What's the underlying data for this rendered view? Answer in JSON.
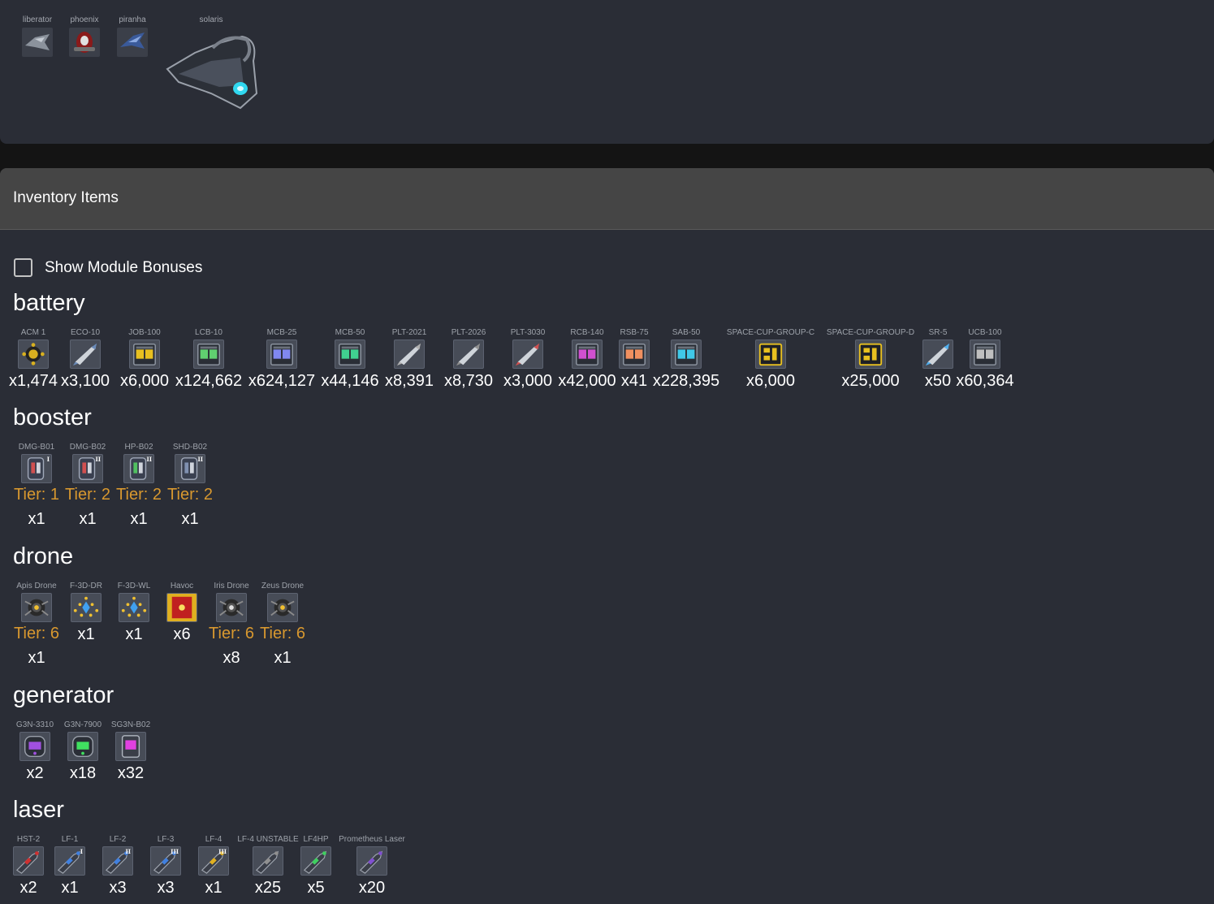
{
  "ships": [
    {
      "name": "liberator",
      "icon": "liberator-ship-icon"
    },
    {
      "name": "phoenix",
      "icon": "phoenix-ship-icon"
    },
    {
      "name": "piranha",
      "icon": "piranha-ship-icon"
    },
    {
      "name": "solaris",
      "icon": "solaris-ship-icon"
    }
  ],
  "inventory": {
    "title": "Inventory Items",
    "show_bonuses_label": "Show Module Bonuses",
    "show_bonuses_checked": false,
    "categories": [
      {
        "name": "battery",
        "items": [
          {
            "name": "ACM 1",
            "qty": "x1,474",
            "icon": "mine-icon",
            "color": "#d8b020"
          },
          {
            "name": "ECO-10",
            "qty": "x3,100",
            "icon": "rocket-icon",
            "color": "#6a8ab8"
          },
          {
            "name": "JOB-100",
            "qty": "x6,000",
            "icon": "ammo-box-icon",
            "color": "#e8c020"
          },
          {
            "name": "LCB-10",
            "qty": "x124,662",
            "icon": "ammo-box-icon",
            "color": "#60d070"
          },
          {
            "name": "MCB-25",
            "qty": "x624,127",
            "icon": "ammo-box-icon",
            "color": "#8088f0"
          },
          {
            "name": "MCB-50",
            "qty": "x44,146",
            "icon": "ammo-box-icon",
            "color": "#40d090"
          },
          {
            "name": "PLT-2021",
            "qty": "x8,391",
            "icon": "rocket-icon",
            "color": "#b0b0b0"
          },
          {
            "name": "PLT-2026",
            "qty": "x8,730",
            "icon": "rocket-icon",
            "color": "#909090"
          },
          {
            "name": "PLT-3030",
            "qty": "x3,000",
            "icon": "rocket-icon",
            "color": "#d05050"
          },
          {
            "name": "RCB-140",
            "qty": "x42,000",
            "icon": "ammo-box-icon",
            "color": "#d050d0"
          },
          {
            "name": "RSB-75",
            "qty": "x41",
            "icon": "ammo-box-icon",
            "color": "#f09060"
          },
          {
            "name": "SAB-50",
            "qty": "x228,395",
            "icon": "ammo-box-icon",
            "color": "#40c8e8"
          },
          {
            "name": "SPACE-CUP-GROUP-C",
            "qty": "x6,000",
            "icon": "cup-box-icon",
            "color": "#e8c020"
          },
          {
            "name": "SPACE-CUP-GROUP-D",
            "qty": "x25,000",
            "icon": "cup-box-icon",
            "color": "#e8c020"
          },
          {
            "name": "SR-5",
            "qty": "x50",
            "icon": "rocket-icon",
            "color": "#50b0f0"
          },
          {
            "name": "UCB-100",
            "qty": "x60,364",
            "icon": "ammo-box-icon",
            "color": "#c0c0c0"
          }
        ]
      },
      {
        "name": "booster",
        "items": [
          {
            "name": "DMG-B01",
            "tier": "Tier: 1",
            "qty": "x1",
            "icon": "booster-icon",
            "roman": "I",
            "color": "#d05050"
          },
          {
            "name": "DMG-B02",
            "tier": "Tier: 2",
            "qty": "x1",
            "icon": "booster-icon",
            "roman": "II",
            "color": "#d05050"
          },
          {
            "name": "HP-B02",
            "tier": "Tier: 2",
            "qty": "x1",
            "icon": "booster-icon",
            "roman": "II",
            "color": "#50c060"
          },
          {
            "name": "SHD-B02",
            "tier": "Tier: 2",
            "qty": "x1",
            "icon": "booster-icon",
            "roman": "II",
            "color": "#8090b0"
          }
        ]
      },
      {
        "name": "drone",
        "items": [
          {
            "name": "Apis Drone",
            "tier": "Tier: 6",
            "qty": "x1",
            "icon": "drone-icon",
            "color": "#f0c030"
          },
          {
            "name": "F-3D-DR",
            "qty": "x1",
            "icon": "formation-icon",
            "color": "#40a0f0"
          },
          {
            "name": "F-3D-WL",
            "qty": "x1",
            "icon": "formation-icon",
            "color": "#40a0f0"
          },
          {
            "name": "Havoc",
            "qty": "x6",
            "icon": "havoc-icon",
            "color": "#c02020"
          },
          {
            "name": "Iris Drone",
            "tier": "Tier: 6",
            "qty": "x8",
            "icon": "drone-icon",
            "color": "#e0e0e0"
          },
          {
            "name": "Zeus Drone",
            "tier": "Tier: 6",
            "qty": "x1",
            "icon": "drone-icon",
            "color": "#f0c030"
          }
        ]
      },
      {
        "name": "generator",
        "items": [
          {
            "name": "G3N-3310",
            "qty": "x2",
            "icon": "generator-icon",
            "color": "#a050e0"
          },
          {
            "name": "G3N-7900",
            "qty": "x18",
            "icon": "generator-icon",
            "color": "#40e060"
          },
          {
            "name": "SG3N-B02",
            "qty": "x32",
            "icon": "shield-generator-icon",
            "color": "#e040e0"
          }
        ]
      },
      {
        "name": "laser",
        "items": [
          {
            "name": "HST-2",
            "qty": "x2",
            "icon": "laser-icon",
            "color": "#d03030"
          },
          {
            "name": "LF-1",
            "qty": "x1",
            "icon": "laser-icon",
            "roman": "I",
            "color": "#4080e0"
          },
          {
            "name": "LF-2",
            "qty": "x3",
            "icon": "laser-icon",
            "roman": "II",
            "color": "#4080e0"
          },
          {
            "name": "LF-3",
            "qty": "x3",
            "icon": "laser-icon",
            "roman": "III",
            "color": "#4080e0"
          },
          {
            "name": "LF-4",
            "qty": "x1",
            "icon": "laser-icon",
            "roman": "III",
            "color": "#e0b020"
          },
          {
            "name": "LF-4 UNSTABLE",
            "qty": "x25",
            "icon": "laser-icon",
            "color": "#909090"
          },
          {
            "name": "LF4HP",
            "qty": "x5",
            "icon": "laser-icon",
            "color": "#40d060"
          },
          {
            "name": "Prometheus Laser",
            "qty": "x20",
            "icon": "laser-icon",
            "color": "#8050d0"
          }
        ]
      }
    ]
  }
}
